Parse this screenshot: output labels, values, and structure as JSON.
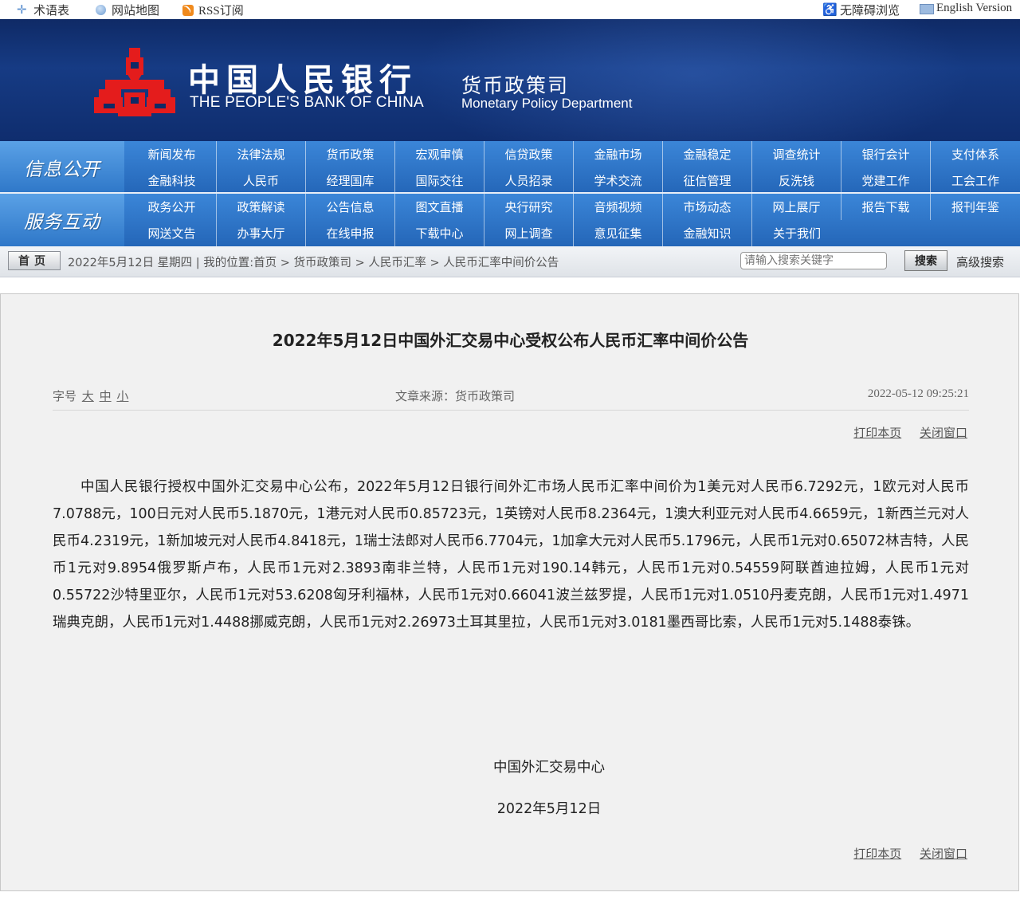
{
  "topbar": {
    "glossary": "术语表",
    "sitemap": "网站地图",
    "rss": "RSS订阅",
    "accessibility": "无障碍浏览",
    "english": "English Version"
  },
  "banner": {
    "bank_cn": "中国人民银行",
    "bank_en": "THE PEOPLE'S BANK OF CHINA",
    "dept_cn": "货币政策司",
    "dept_en": "Monetary Policy Department",
    "logo_color": "#e41c1c"
  },
  "nav": {
    "group1": {
      "title": "信息公开",
      "row1": [
        "新闻发布",
        "法律法规",
        "货币政策",
        "宏观审慎",
        "信贷政策",
        "金融市场",
        "金融稳定",
        "调查统计",
        "银行会计",
        "支付体系"
      ],
      "row2": [
        "金融科技",
        "人民币",
        "经理国库",
        "国际交往",
        "人员招录",
        "学术交流",
        "征信管理",
        "反洗钱",
        "党建工作",
        "工会工作"
      ]
    },
    "group2": {
      "title": "服务互动",
      "row1": [
        "政务公开",
        "政策解读",
        "公告信息",
        "图文直播",
        "央行研究",
        "音频视频",
        "市场动态",
        "网上展厅",
        "报告下载",
        "报刊年鉴"
      ],
      "row2": [
        "网送文告",
        "办事大厅",
        "在线申报",
        "下载中心",
        "网上调查",
        "意见征集",
        "金融知识",
        "关于我们"
      ]
    }
  },
  "crumbbar": {
    "home": "首页",
    "crumb": "2022年5月12日 星期四 | 我的位置:首页 > 货币政策司 > 人民币汇率 > 人民币汇率中间价公告",
    "search_placeholder": "请输入搜索关键字",
    "search_button": "搜索",
    "advanced": "高级搜索"
  },
  "article": {
    "title": "2022年5月12日中国外汇交易中心受权公布人民币汇率中间价公告",
    "font_size_label": "字号",
    "size_large": "大",
    "size_medium": "中",
    "size_small": "小",
    "source": "文章来源：货币政策司",
    "datetime": "2022-05-12 09:25:21",
    "print": "打印本页",
    "close": "关闭窗口",
    "body": "中国人民银行授权中国外汇交易中心公布，2022年5月12日银行间外汇市场人民币汇率中间价为1美元对人民币6.7292元，1欧元对人民币7.0788元，100日元对人民币5.1870元，1港元对人民币0.85723元，1英镑对人民币8.2364元，1澳大利亚元对人民币4.6659元，1新西兰元对人民币4.2319元，1新加坡元对人民币4.8418元，1瑞士法郎对人民币6.7704元，1加拿大元对人民币5.1796元，人民币1元对0.65072林吉特，人民币1元对9.8954俄罗斯卢布，人民币1元对2.3893南非兰特，人民币1元对190.14韩元，人民币1元对0.54559阿联酋迪拉姆，人民币1元对0.55722沙特里亚尔，人民币1元对53.6208匈牙利福林，人民币1元对0.66041波兰兹罗提，人民币1元对1.0510丹麦克朗，人民币1元对1.4971瑞典克朗，人民币1元对1.4488挪威克朗，人民币1元对2.26973土耳其里拉，人民币1元对3.0181墨西哥比索，人民币1元对5.1488泰铢。",
    "signature": "中国外汇交易中心",
    "date": "2022年5月12日"
  }
}
